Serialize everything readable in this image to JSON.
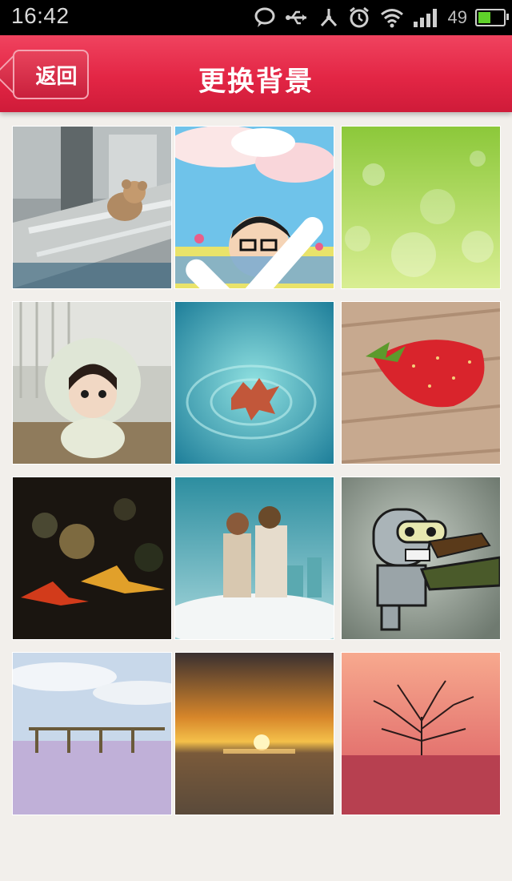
{
  "status_bar": {
    "time": "16:42",
    "battery": "49",
    "battery_level": 0.49
  },
  "header": {
    "back_label": "返回",
    "title": "更换背景"
  },
  "colors": {
    "header": "#e32645",
    "selected_bar": "#78aad2",
    "battery_fill": "#5fd12a"
  },
  "grid": {
    "selected_index": 1,
    "tiles": [
      {
        "name": "bear-on-bench"
      },
      {
        "name": "cartoon-girl-sky"
      },
      {
        "name": "green-bokeh"
      },
      {
        "name": "doll-in-hood"
      },
      {
        "name": "leaf-on-water"
      },
      {
        "name": "strawberry-on-wood"
      },
      {
        "name": "paper-cranes"
      },
      {
        "name": "couple-in-clouds"
      },
      {
        "name": "cartoon-robot"
      },
      {
        "name": "beach-pier"
      },
      {
        "name": "sunset-sea"
      },
      {
        "name": "tree-silhouette-pink"
      }
    ]
  }
}
